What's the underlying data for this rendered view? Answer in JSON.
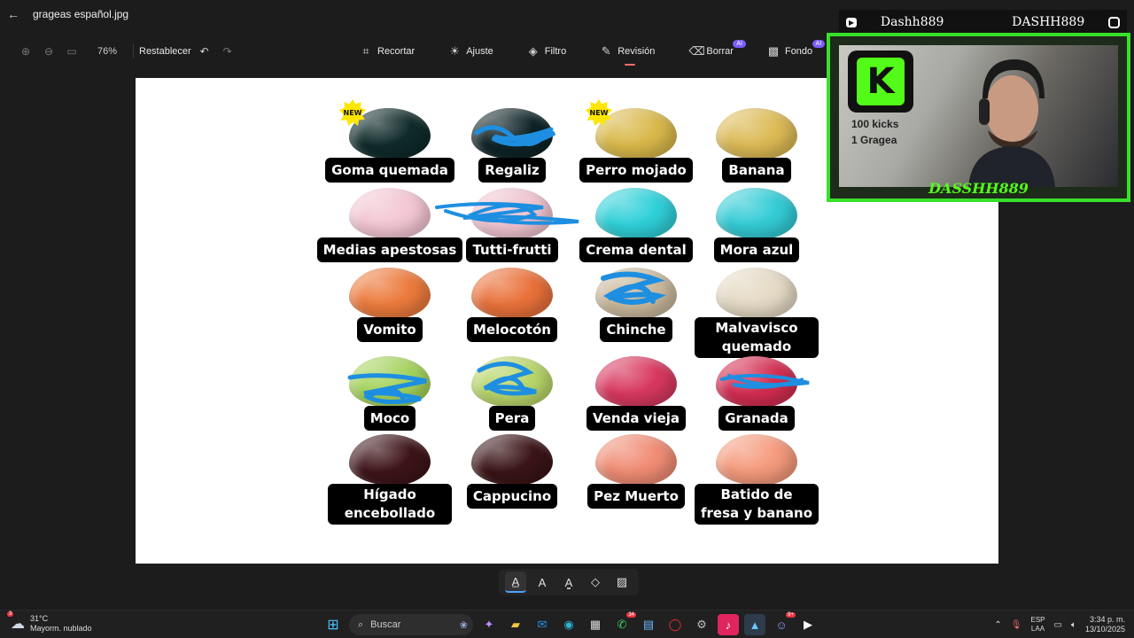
{
  "window": {
    "title": "grageas español.jpg"
  },
  "toolbar": {
    "zoom": "76%",
    "reset_label": "Restablecer",
    "tools": [
      {
        "label": "Recortar",
        "icon": "crop-icon"
      },
      {
        "label": "Ajuste",
        "icon": "brightness-icon"
      },
      {
        "label": "Filtro",
        "icon": "filter-icon"
      },
      {
        "label": "Revisión",
        "icon": "markup-icon",
        "active": true
      },
      {
        "label": "Borrar",
        "icon": "erase-icon",
        "badge": "AI"
      },
      {
        "label": "Fondo",
        "icon": "background-icon",
        "badge": "AI"
      }
    ]
  },
  "image": {
    "beans": [
      {
        "label": "Goma quemada",
        "color": "#0f2a2a",
        "new": true
      },
      {
        "label": "Regaliz",
        "color": "#0e2326",
        "scribbled": true
      },
      {
        "label": "Perro mojado",
        "color": "#d9b84a",
        "new": true
      },
      {
        "label": "Banana",
        "color": "#dcba55"
      },
      {
        "label": "Medias apestosas",
        "color": "#f3c6d3"
      },
      {
        "label": "Tutti-frutti",
        "color": "#f0c3cf",
        "scribbled": true
      },
      {
        "label": "Crema dental",
        "color": "#2fd0d9"
      },
      {
        "label": "Mora azul",
        "color": "#33ccd6"
      },
      {
        "label": "Vomito",
        "color": "#ec7a3c"
      },
      {
        "label": "Melocotón",
        "color": "#e9713a"
      },
      {
        "label": "Chinche",
        "color": "#c9b89c",
        "scribbled": true
      },
      {
        "label": "Malvavisco quemado",
        "color": "#e4d9c4"
      },
      {
        "label": "Moco",
        "color": "#a3d25a",
        "scribbled": true
      },
      {
        "label": "Pera",
        "color": "#b8d66a",
        "scribbled": true
      },
      {
        "label": "Venda vieja",
        "color": "#d8385f"
      },
      {
        "label": "Granada",
        "color": "#d22c50",
        "scribbled": true
      },
      {
        "label": "Hígado encebollado",
        "color": "#3d1418"
      },
      {
        "label": "Cappucino",
        "color": "#3a1416"
      },
      {
        "label": "Pez Muerto",
        "color": "#f08c74"
      },
      {
        "label": "Batido de fresa y banano",
        "color": "#f59a7c"
      }
    ],
    "new_badge": "NEW",
    "scribble_color": "#1e8fe0"
  },
  "webcam": {
    "youtube_name": "Dashh889",
    "instagram_name": "DASHH889",
    "kick_line1": "100 kicks",
    "kick_line2": "1 Gragea",
    "overlay_name": "DASSHH889",
    "accent": "#53fc18"
  },
  "taskbar": {
    "temperature": "31°C",
    "weather": "Mayorm. nublado",
    "weather_badge": "3",
    "search_placeholder": "Buscar",
    "whatsapp_badge": "34",
    "discord_badge": "9+",
    "lang1": "ESP",
    "lang2": "LAA",
    "time": "3:34 p. m.",
    "date": "13/10/2025"
  }
}
